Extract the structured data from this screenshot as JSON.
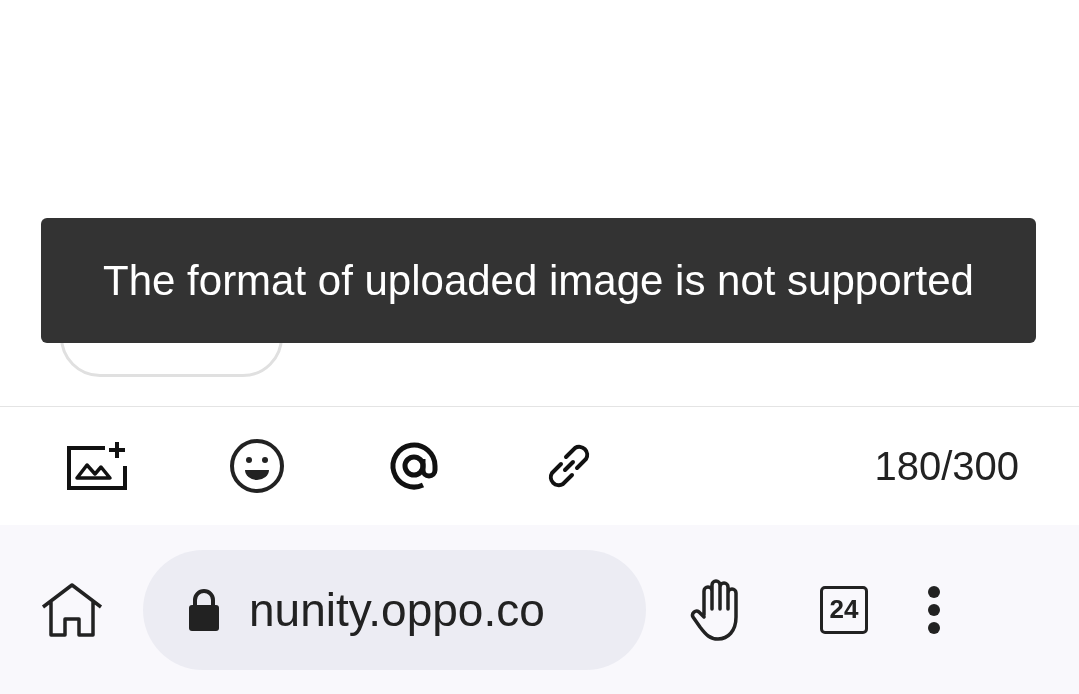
{
  "toast": {
    "message": "The format of uploaded image is not supported"
  },
  "toolbar": {
    "counter": "180/300"
  },
  "browser_bar": {
    "url": "nunity.oppo.co",
    "tab_count": "24"
  }
}
